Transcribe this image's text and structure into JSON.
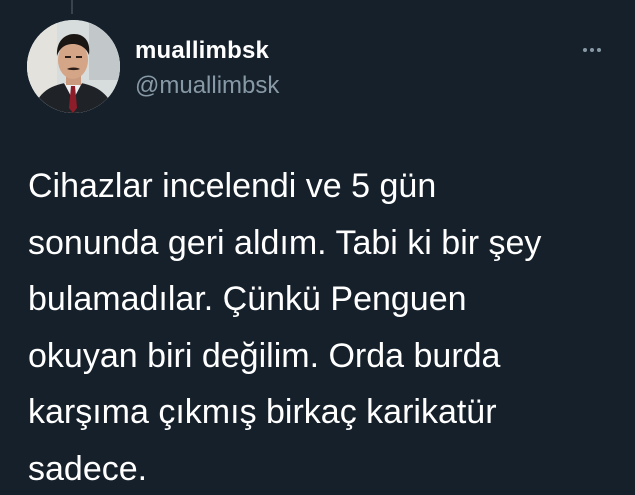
{
  "tweet": {
    "author": {
      "display_name": "muallimbsk",
      "handle": "@muallimbsk"
    },
    "more_icon": "more-horizontal-icon",
    "text_lines": [
      "Cihazlar incelendi ve 5 gün",
      "sonunda geri aldım. Tabi ki bir şey",
      "bulamadılar. Çünkü Penguen",
      "okuyan biri değilim. Orda burda",
      "karşıma çıkmış birkaç karikatür",
      "sadece."
    ]
  },
  "colors": {
    "background": "#15202b",
    "primary_text": "#ffffff",
    "secondary_text": "#8899a6",
    "thread_line": "#38444d"
  }
}
